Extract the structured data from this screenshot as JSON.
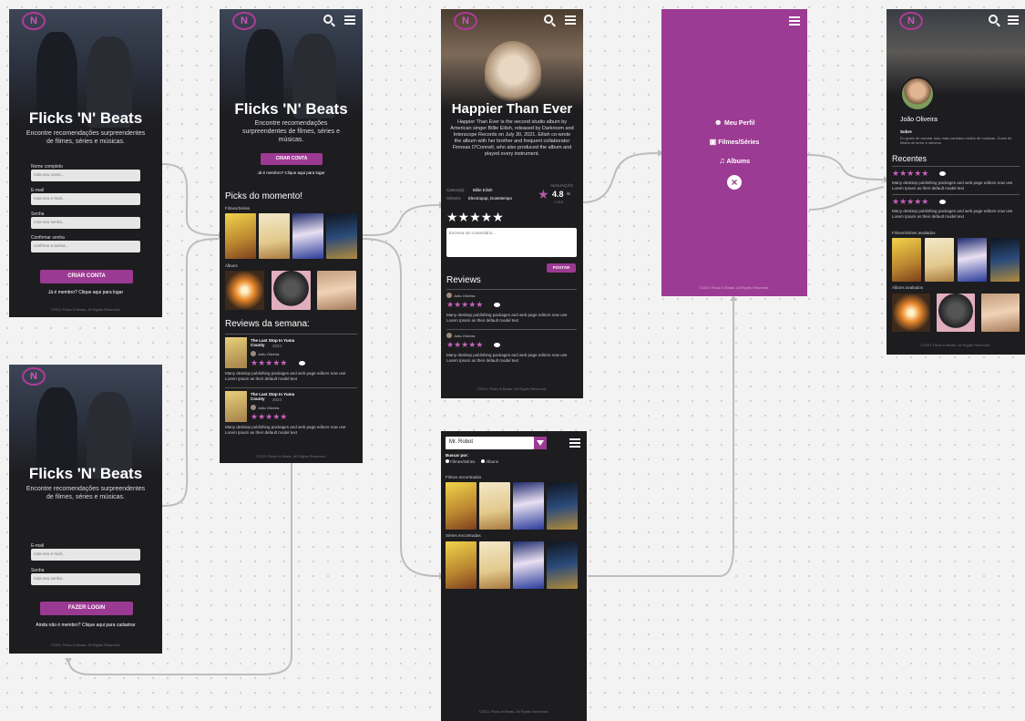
{
  "brand": {
    "logo_letter": "N",
    "accent": "#9b3a92"
  },
  "signup": {
    "title": "Flicks 'N' Beats",
    "subtitle": "Encontre recomendações surpreendentes de filmes, séries e músicas.",
    "fields": [
      {
        "label": "Nome completo",
        "placeholder": "nota seu nome..."
      },
      {
        "label": "E-mail",
        "placeholder": "nota seu e-mail..."
      },
      {
        "label": "Senha",
        "placeholder": "nota seu senha..."
      },
      {
        "label": "Confirmar senha",
        "placeholder": "confirme a senha..."
      }
    ],
    "button": "CRIAR CONTA",
    "link": "Já é membro? Clique aqui para logar",
    "footer": "©2021 Flicks N Beats. All Rights Reserved."
  },
  "login": {
    "title": "Flicks 'N' Beats",
    "subtitle": "Encontre recomendações surpreendentes de filmes, séries e músicas.",
    "fields": [
      {
        "label": "E-mail",
        "placeholder": "nota seu e-mail..."
      },
      {
        "label": "Senha",
        "placeholder": "nota seu senha..."
      }
    ],
    "button": "FAZER LOGIN",
    "link": "Ainda não é membro? Clique aqui para cadastrar",
    "footer": "©2021 Flicks N Beats. All Rights Reserved."
  },
  "home": {
    "title": "Flicks 'N' Beats",
    "subtitle": "Encontre recomendações surpreendentes de filmes, séries e músicas.",
    "button": "CRIAR CONTA",
    "link": "Já é membro? Clique aqui para logar",
    "picks_title": "Picks do momento!",
    "picks_films_label": "Filmes/Séries",
    "picks_albums_label": "Álbuns",
    "reviews_title": "Reviews da semana:",
    "reviews": [
      {
        "title": "The Last Stop In Yuma County",
        "year": "2024",
        "user": "João Oliveira",
        "stars": "★★★★★",
        "text": "Many desktop publishing packages and web page editors now use Lorem Ipsum as their default model text"
      },
      {
        "title": "The Last Stop In Yuma County",
        "year": "2024",
        "user": "João Oliveira",
        "stars": "★★★★★",
        "text": "Many desktop publishing packages and web page editors now use Lorem Ipsum as their default model text"
      }
    ],
    "footer": "©2021 Flicks N Beats. All Rights Reserved."
  },
  "album": {
    "title": "Happier Than Ever",
    "description": "Happier Than Ever is the second studio album by American singer Billie Eilish, released by Darkroom and Interscope Records on July 30, 2021. Eilish co-wrote the album with her brother and frequent collaborator Finneas O'Connell, who also produced the album and played every instrument.",
    "artist_label": "Cantor(a):",
    "artist": "Billie Eilish",
    "genre_label": "Gênero:",
    "genre": "Electropop, Downtempo",
    "rating_label": "AVALIAÇÃO",
    "rating_value": "4.8",
    "rating_max": "/5",
    "rating_count": "1.215",
    "user_stars": "★★★★★",
    "comment_placeholder": "Escreva um comentário...",
    "post_button": "POSTAR",
    "reviews_title": "Reviews",
    "reviews": [
      {
        "user": "João Oliveira",
        "stars": "★★★★★",
        "text": "Many desktop publishing packages and web page editors now use Lorem Ipsum as their default model text"
      },
      {
        "user": "João Oliveira",
        "stars": "★★★★★",
        "text": "Many desktop publishing packages and web page editors now use Lorem Ipsum as their default model text"
      }
    ],
    "footer": "©2021 Flicks N Beats. All Rights Reserved."
  },
  "menu": {
    "items": [
      {
        "icon": "user-icon",
        "label": "Meu Perfil"
      },
      {
        "icon": "video-camera-icon",
        "label": "Filmes/Séries"
      },
      {
        "icon": "music-note-icon",
        "label": "Albums"
      }
    ],
    "close": "×",
    "footer": "©2021 Flicks N Beats. All Rights Reserved."
  },
  "search": {
    "query": "Mr. Robot",
    "filter_label": "Buscar por:",
    "options": [
      "Filmes/Séries",
      "Álbuns"
    ],
    "films_label": "Filmes encontrados",
    "series_label": "Séries encontradas",
    "footer": "©2021 Flicks N Beats. All Rights Reserved."
  },
  "profile": {
    "name": "João Oliveira",
    "about_label": "Sobre",
    "about": "Eu gosto de escutar tudo mais variados estilos de músicas. Gosto de filmes de terror e sitcoms.",
    "recent_title": "Recentes",
    "recent": [
      {
        "stars": "★★★★★",
        "text": "Many desktop publishing packages and web page editors now use Lorem Ipsum as their default model text"
      },
      {
        "stars": "★★★★★",
        "text": "Many desktop publishing packages and web page editors now use Lorem Ipsum as their default model text"
      }
    ],
    "films_label": "Filmes/Séries avaliados",
    "albums_label": "Álbuns avaliados",
    "footer": "©2021 Flicks N Beats. All Rights Reserved."
  }
}
